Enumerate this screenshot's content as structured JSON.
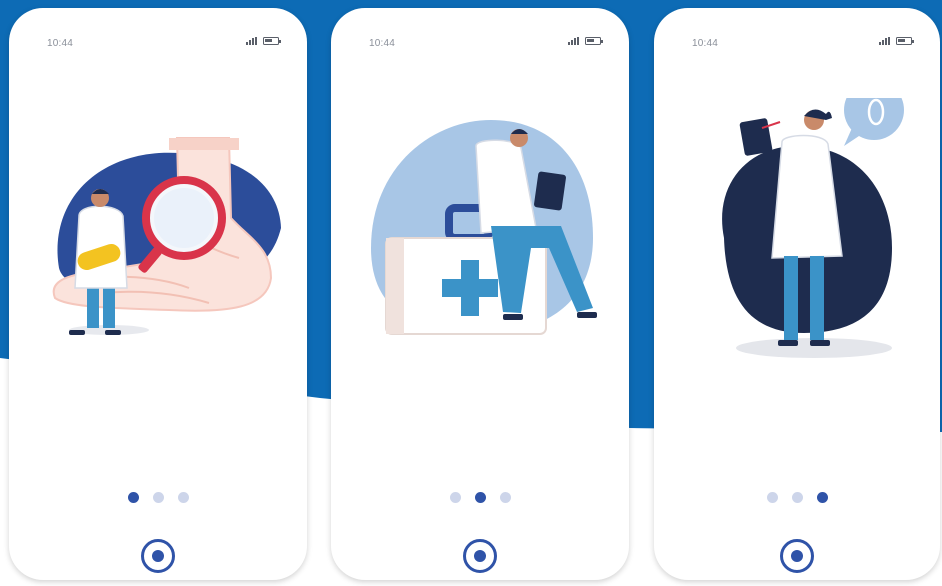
{
  "colors": {
    "brand_blue": "#0d6bb5",
    "dot_active": "#2f53a8",
    "dot_inactive": "#cdd5ea",
    "illustration_navy": "#1e2c4e",
    "illustration_light_blue": "#a8c6e6",
    "illustration_royal_blue": "#2c4d9a"
  },
  "screens": [
    {
      "status_time": "10:44",
      "illustration": "doctor-examining-foot-with-magnifier",
      "pager": {
        "count": 3,
        "active_index": 0
      },
      "action_icon": "target-icon"
    },
    {
      "status_time": "10:44",
      "illustration": "doctor-sitting-on-first-aid-kit",
      "pager": {
        "count": 3,
        "active_index": 1
      },
      "action_icon": "target-icon"
    },
    {
      "status_time": "10:44",
      "illustration": "doctor-with-clipboard-foot-bubble",
      "pager": {
        "count": 3,
        "active_index": 2
      },
      "action_icon": "target-icon"
    }
  ]
}
